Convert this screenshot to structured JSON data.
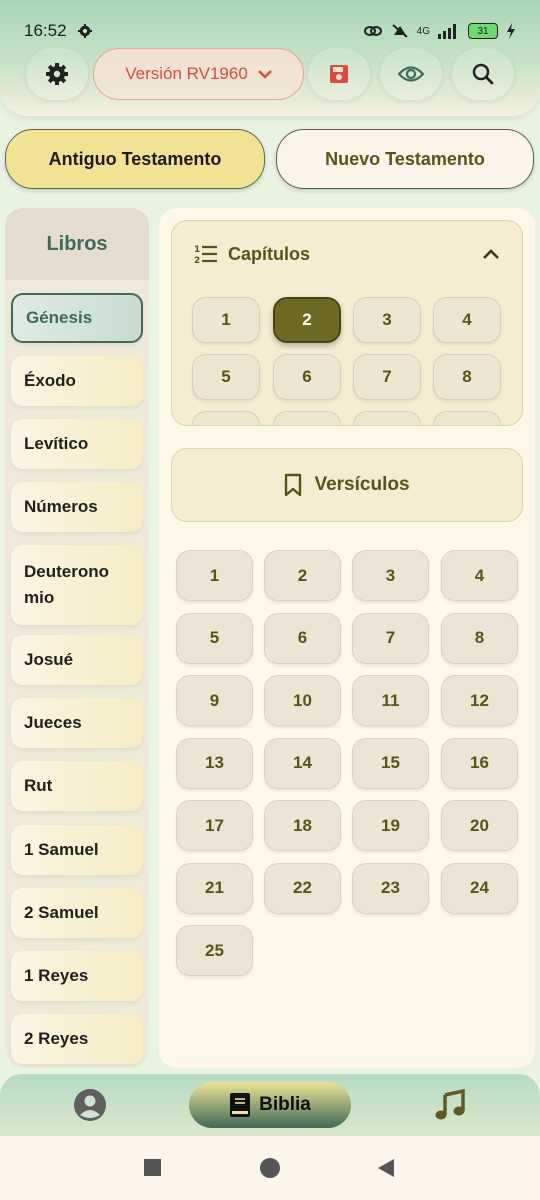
{
  "status_bar": {
    "time": "16:52",
    "network": "4G",
    "battery": "31"
  },
  "toolbar": {
    "version_label": "Versión RV1960",
    "icons": [
      "gear-icon",
      "chevron-down-icon",
      "save-icon",
      "eye-icon",
      "search-icon"
    ]
  },
  "testaments": {
    "old": "Antiguo Testamento",
    "new": "Nuevo Testamento",
    "selected": "old"
  },
  "books": {
    "title": "Libros",
    "items": [
      "Génesis",
      "Éxodo",
      "Levítico",
      "Números",
      "Deuterono mio",
      "Josué",
      "Jueces",
      "Rut",
      "1 Samuel",
      "2 Samuel",
      "1 Reyes",
      "2 Reyes"
    ],
    "selected": "Génesis"
  },
  "chapters": {
    "title": "Capítulos",
    "items": [
      "1",
      "2",
      "3",
      "4",
      "5",
      "6",
      "7",
      "8"
    ],
    "selected": "2"
  },
  "verses": {
    "title": "Versículos",
    "items": [
      "1",
      "2",
      "3",
      "4",
      "5",
      "6",
      "7",
      "8",
      "9",
      "10",
      "11",
      "12",
      "13",
      "14",
      "15",
      "16",
      "17",
      "18",
      "19",
      "20",
      "21",
      "22",
      "23",
      "24",
      "25"
    ]
  },
  "bottom_nav": {
    "bible_label": "Biblia",
    "icons": [
      "profile-icon",
      "bible-icon",
      "music-icon"
    ]
  },
  "colors": {
    "accent": "#6f6a23",
    "brand_green": "#3e6a58",
    "version_red": "#e0483e"
  }
}
